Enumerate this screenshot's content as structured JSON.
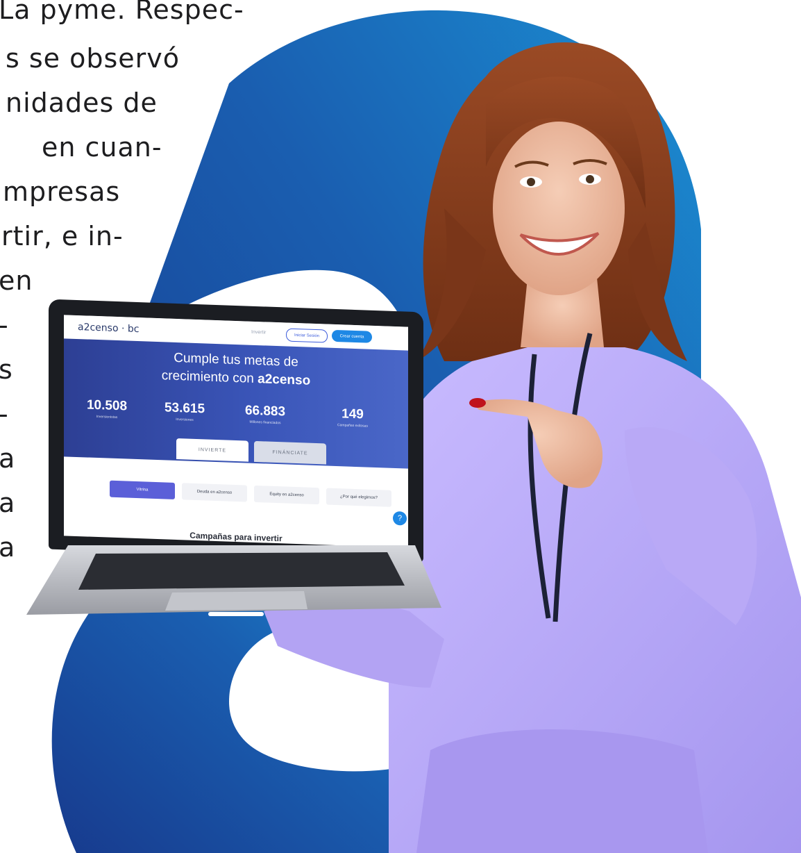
{
  "article": {
    "lines": [
      "La pyme. Respec-",
      "s se observó",
      "nidades de",
      "en cuan-",
      "mpresas",
      "rtir, e in-",
      "en",
      "-",
      "s",
      "-",
      "a",
      "a",
      "a"
    ]
  },
  "laptop_screen": {
    "logo": "a2censo · bc",
    "nav_link": "Invertir",
    "login_label": "Iniciar Sesión",
    "signup_label": "Crear cuenta",
    "hero_title_line1": "Cumple tus metas de",
    "hero_title_line2_prefix": "crecimiento con ",
    "hero_title_brand": "a2censo",
    "stats": [
      {
        "value": "10.508",
        "label": "Inversionistas"
      },
      {
        "value": "53.615",
        "label": "Inversiones"
      },
      {
        "value": "66.883",
        "label": "Millones financiados"
      },
      {
        "value": "149",
        "label": "Campañas exitosas"
      }
    ],
    "tabs": [
      "INVIERTE",
      "FINÁNCIATE"
    ],
    "pills": [
      "Vitrina",
      "Deuda en a2censo",
      "Equity en a2censo",
      "¿Por qué elegirnos?"
    ],
    "help_glyph": "?",
    "section_title": "Campañas para invertir"
  },
  "colors": {
    "brand_dark": "#1b3f8f",
    "brand_light": "#1f8fd1",
    "hoodie": "#b8a6f5",
    "hero": "#3a55b8"
  }
}
